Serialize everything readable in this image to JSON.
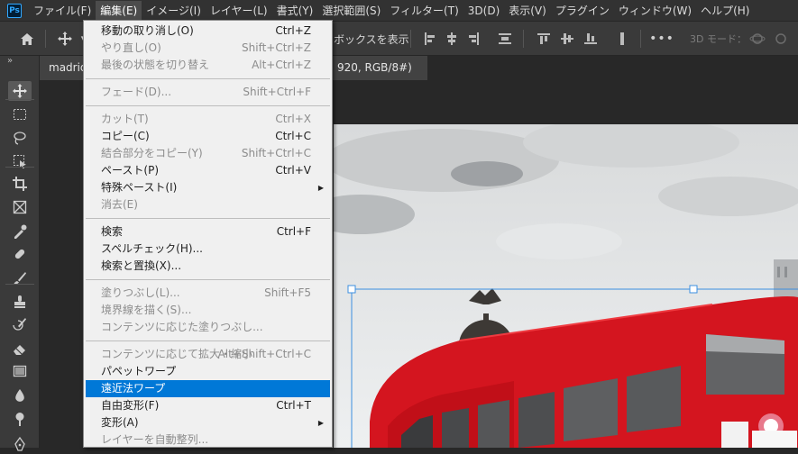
{
  "app": {
    "logo_text": "Ps"
  },
  "menubar": {
    "items": [
      "ファイル(F)",
      "編集(E)",
      "イメージ(I)",
      "レイヤー(L)",
      "書式(Y)",
      "選択範囲(S)",
      "フィルター(T)",
      "3D(D)",
      "表示(V)",
      "プラグイン",
      "ウィンドウ(W)",
      "ヘルプ(H)"
    ],
    "active_index": 1
  },
  "options_bar": {
    "show_transform_label": "ボックスを表示",
    "mode_3d_label": "3D モード："
  },
  "tools": {
    "collapse_label": "»",
    "icons": [
      "move-tool-icon",
      "marquee-tool-icon",
      "lasso-tool-icon",
      "object-select-tool-icon",
      "crop-tool-icon",
      "frame-tool-icon",
      "eyedropper-tool-icon",
      "healing-brush-tool-icon",
      "brush-tool-icon",
      "clone-stamp-tool-icon",
      "history-brush-tool-icon",
      "eraser-tool-icon",
      "gradient-tool-icon",
      "blur-tool-icon",
      "dodge-tool-icon",
      "pen-tool-icon"
    ]
  },
  "document": {
    "tab_a_label": "madrid",
    "tab_b_label": "920, RGB/8#) *",
    "tab_close": "×"
  },
  "edit_menu": {
    "groups": [
      [
        {
          "label": "移動の取り消し(O)",
          "shortcut": "Ctrl+Z",
          "disabled": false
        },
        {
          "label": "やり直し(O)",
          "shortcut": "Shift+Ctrl+Z",
          "disabled": true
        },
        {
          "label": "最後の状態を切り替え",
          "shortcut": "Alt+Ctrl+Z",
          "disabled": true
        }
      ],
      [
        {
          "label": "フェード(D)...",
          "shortcut": "Shift+Ctrl+F",
          "disabled": true
        }
      ],
      [
        {
          "label": "カット(T)",
          "shortcut": "Ctrl+X",
          "disabled": true
        },
        {
          "label": "コピー(C)",
          "shortcut": "Ctrl+C",
          "disabled": false
        },
        {
          "label": "結合部分をコピー(Y)",
          "shortcut": "Shift+Ctrl+C",
          "disabled": true
        },
        {
          "label": "ペースト(P)",
          "shortcut": "Ctrl+V",
          "disabled": false
        },
        {
          "label": "特殊ペースト(I)",
          "shortcut": "",
          "disabled": false,
          "submenu": true
        },
        {
          "label": "消去(E)",
          "shortcut": "",
          "disabled": true
        }
      ],
      [
        {
          "label": "検索",
          "shortcut": "Ctrl+F",
          "disabled": false
        },
        {
          "label": "スペルチェック(H)...",
          "shortcut": "",
          "disabled": false
        },
        {
          "label": "検索と置換(X)...",
          "shortcut": "",
          "disabled": false
        }
      ],
      [
        {
          "label": "塗りつぶし(L)...",
          "shortcut": "Shift+F5",
          "disabled": true
        },
        {
          "label": "境界線を描く(S)...",
          "shortcut": "",
          "disabled": true
        },
        {
          "label": "コンテンツに応じた塗りつぶし...",
          "shortcut": "",
          "disabled": true
        }
      ],
      [
        {
          "label": "コンテンツに応じて拡大・縮小",
          "shortcut": "Alt+Shift+Ctrl+C",
          "disabled": true
        },
        {
          "label": "パペットワープ",
          "shortcut": "",
          "disabled": false
        },
        {
          "label": "遠近法ワープ",
          "shortcut": "",
          "disabled": false,
          "highlighted": true
        },
        {
          "label": "自由変形(F)",
          "shortcut": "Ctrl+T",
          "disabled": false
        },
        {
          "label": "変形(A)",
          "shortcut": "",
          "disabled": false,
          "submenu": true
        },
        {
          "label": "レイヤーを自動整列...",
          "shortcut": "",
          "disabled": true
        }
      ]
    ],
    "submenu_arrow": "▶"
  },
  "colors": {
    "highlight": "#0078d7",
    "bus_red": "#d4151f",
    "selection_outline": "#3b8fe0"
  }
}
